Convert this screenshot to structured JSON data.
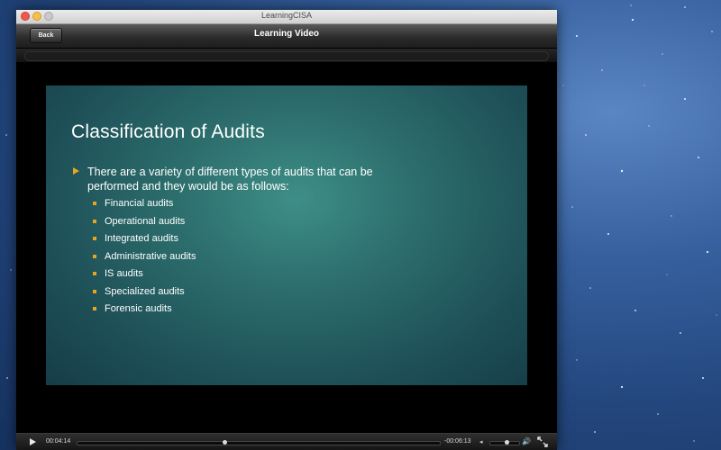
{
  "window": {
    "title": "LearningCISA"
  },
  "navbar": {
    "back_label": "Back",
    "title": "Learning Video"
  },
  "slide": {
    "title": "Classification of Audits",
    "lead": "There are a variety of different types of audits that can be performed and they would be as follows:",
    "items": [
      "Financial audits",
      "Operational audits",
      "Integrated audits",
      "Administrative audits",
      "IS audits",
      "Specialized audits",
      "Forensic audits"
    ],
    "colors": {
      "bullet": "#e9a51e",
      "text": "#ffffff"
    }
  },
  "player": {
    "elapsed": "00:04:14",
    "remaining": "-00:06:13",
    "progress": 0.405,
    "volume": 0.55,
    "icons": {
      "play": "play-icon",
      "volume_low": "volume-low-icon",
      "volume_high": "volume-high-icon",
      "fullscreen": "fullscreen-icon"
    }
  }
}
